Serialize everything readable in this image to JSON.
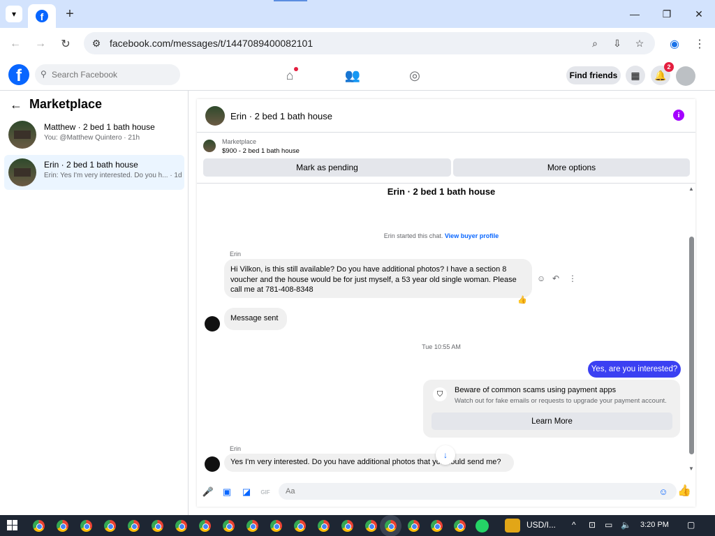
{
  "browser": {
    "url": "facebook.com/messages/t/1447089400082101",
    "new_tab_label": "+"
  },
  "facebook": {
    "logo": "f",
    "search_placeholder": "Search Facebook",
    "find_friends": "Find friends",
    "notification_count": "2"
  },
  "sidebar": {
    "title": "Marketplace",
    "conversations": [
      {
        "title": "Matthew · 2 bed 1 bath house",
        "snippet": "You: @Matthew Quintero · 21h"
      },
      {
        "title": "Erin · 2 bed 1 bath house",
        "snippet": "Erin: Yes I'm very interested. Do you h... · 1d"
      }
    ]
  },
  "chat": {
    "header_title": "Erin · 2 bed 1 bath house",
    "info_icon": "i",
    "listing_label": "Marketplace",
    "listing_title": "$900 - 2 bed 1 bath house",
    "mark_pending": "Mark as pending",
    "more_options": "More options",
    "thread_title": "Erin · 2 bed 1 bath house",
    "started_text": "Erin started this chat.",
    "view_profile": "View buyer profile",
    "msg1_sender": "Erin",
    "msg1_text": "Hi Vilkon, is this still available? Do you have additional photos?  I have a section 8 voucher and the house would be for just myself, a 53 year old single woman. Please call me at 781-408-8348",
    "msg2_text": "Message sent",
    "timestamp": "Tue 10:55 AM",
    "my_msg": "Yes, are you interested?",
    "scam_title": "Beware of common scams using payment apps",
    "scam_desc": "Watch out for fake emails or requests to upgrade your payment account.",
    "learn_more": "Learn More",
    "msg3_sender": "Erin",
    "msg3_text": "Yes I'm very interested.  Do you have additional photos that you could send me?",
    "composer_placeholder": "Aa",
    "gif_label": "GIF"
  },
  "taskbar": {
    "currency": "USD/I...",
    "time": "3:20 PM"
  },
  "colors": {
    "fb_blue": "#0866ff",
    "my_bubble": "#3b40f2",
    "info_purple": "#a400ff",
    "badge_red": "#e41e3f"
  }
}
